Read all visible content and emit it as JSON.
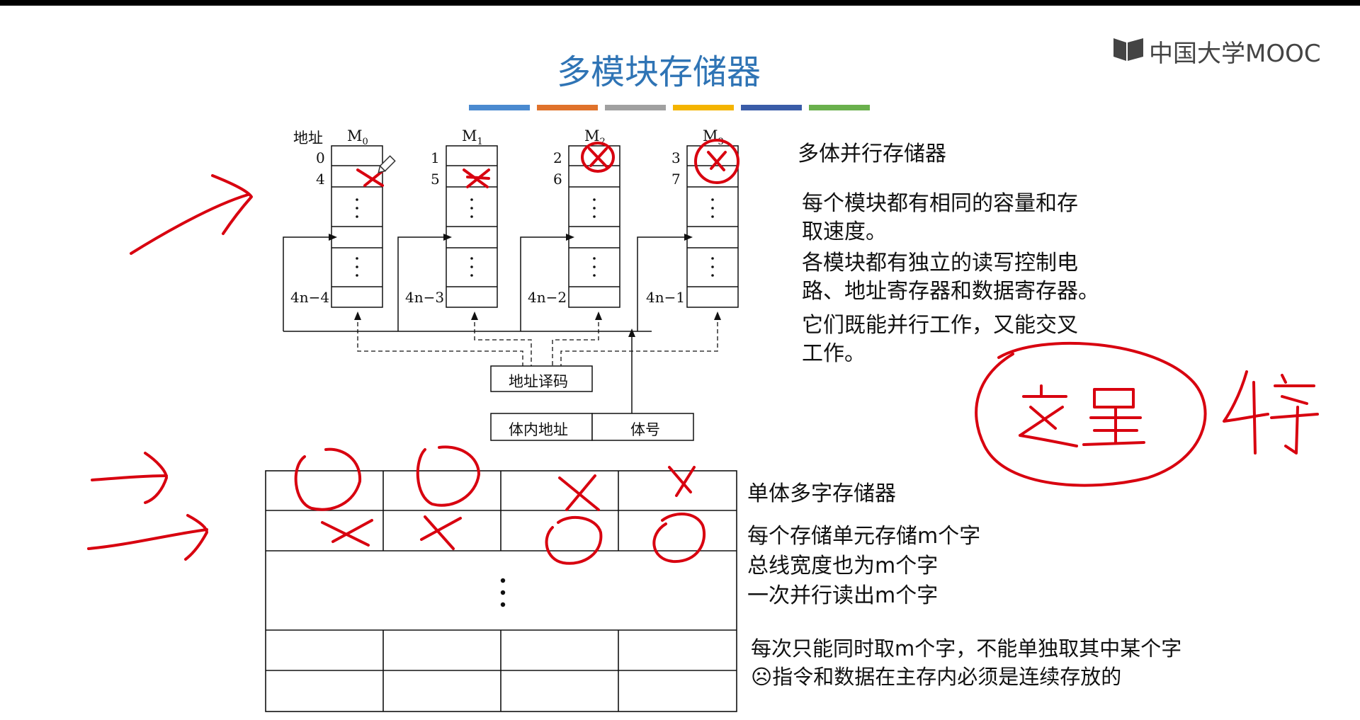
{
  "title": "多模块存储器",
  "logo_text": "中国大学MOOC",
  "color_bar": [
    "#4a8ad0",
    "#e0722b",
    "#a0a0a0",
    "#f4b400",
    "#3a5ca8",
    "#6ab04c"
  ],
  "multi_bank": {
    "heading": "多体并行存储器",
    "addr_label": "地址",
    "banks": [
      {
        "name": "M",
        "sub": "0",
        "first": "0",
        "second": "4",
        "last": "4n−4"
      },
      {
        "name": "M",
        "sub": "1",
        "first": "1",
        "second": "5",
        "last": "4n−3"
      },
      {
        "name": "M",
        "sub": "2",
        "first": "2",
        "second": "6",
        "last": "4n−2"
      },
      {
        "name": "M",
        "sub": "3",
        "first": "3",
        "second": "7",
        "last": "4n−1"
      }
    ],
    "decoder": "地址译码",
    "in_bank_addr": "体内地址",
    "bank_no": "体号",
    "desc": [
      "每个模块都有相同的容量和存",
      "取速度。",
      "各模块都有独立的读写控制电",
      "路、地址寄存器和数据寄存器。",
      "它们既能并行工作，又能交叉",
      "工作。"
    ]
  },
  "single_bank": {
    "heading": "单体多字存储器",
    "desc": [
      "每个存储单元存储m个字",
      "总线宽度也为m个字",
      "一次并行读出m个字"
    ],
    "note": [
      "每次只能同时取m个字，不能单独取其中某个字",
      "☹指令和数据在主存内必须是连续存放的"
    ]
  },
  "annotation_colors": {
    "ink": "#d8000f"
  }
}
